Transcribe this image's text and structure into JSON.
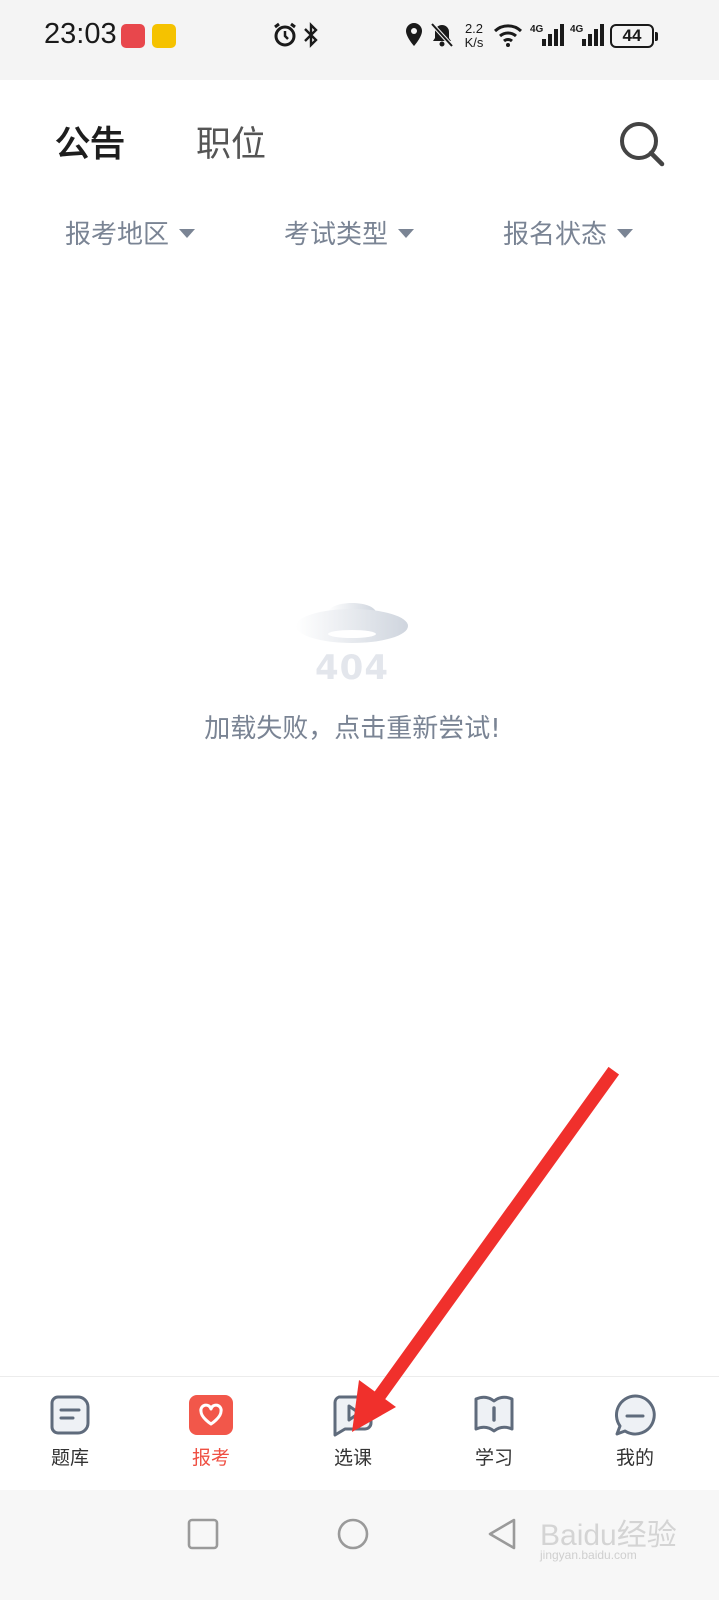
{
  "status_bar": {
    "time": "23:03",
    "net_speed_value": "2.2",
    "net_speed_unit": "K/s",
    "battery": "44",
    "icons": [
      "app-badge-icon",
      "app-badge-icon",
      "alarm-icon",
      "bluetooth-icon",
      "location-icon",
      "mute-icon",
      "wifi-icon",
      "signal-4g-icon",
      "signal-4g-icon",
      "battery-icon"
    ]
  },
  "header": {
    "tabs": [
      {
        "label": "公告",
        "active": true
      },
      {
        "label": "职位",
        "active": false
      }
    ],
    "search_icon": "search-icon"
  },
  "filters": [
    {
      "label": "报考地区"
    },
    {
      "label": "考试类型"
    },
    {
      "label": "报名状态"
    }
  ],
  "error_state": {
    "code": "404",
    "message": "加载失败，点击重新尝试!"
  },
  "bottom_nav": {
    "items": [
      {
        "label": "题库",
        "icon": "question-bank-icon",
        "active": false
      },
      {
        "label": "报考",
        "icon": "heart-icon",
        "active": true
      },
      {
        "label": "选课",
        "icon": "play-icon",
        "active": false
      },
      {
        "label": "学习",
        "icon": "book-icon",
        "active": false
      },
      {
        "label": "我的",
        "icon": "chat-bubble-icon",
        "active": false
      }
    ]
  },
  "system_nav": {
    "watermark": "Baidu经验",
    "watermark_sub": "jingyan.baidu.com"
  },
  "colors": {
    "accent": "#ef5043",
    "muted_text": "#7a8494",
    "annotation_arrow": "#f0302c"
  }
}
